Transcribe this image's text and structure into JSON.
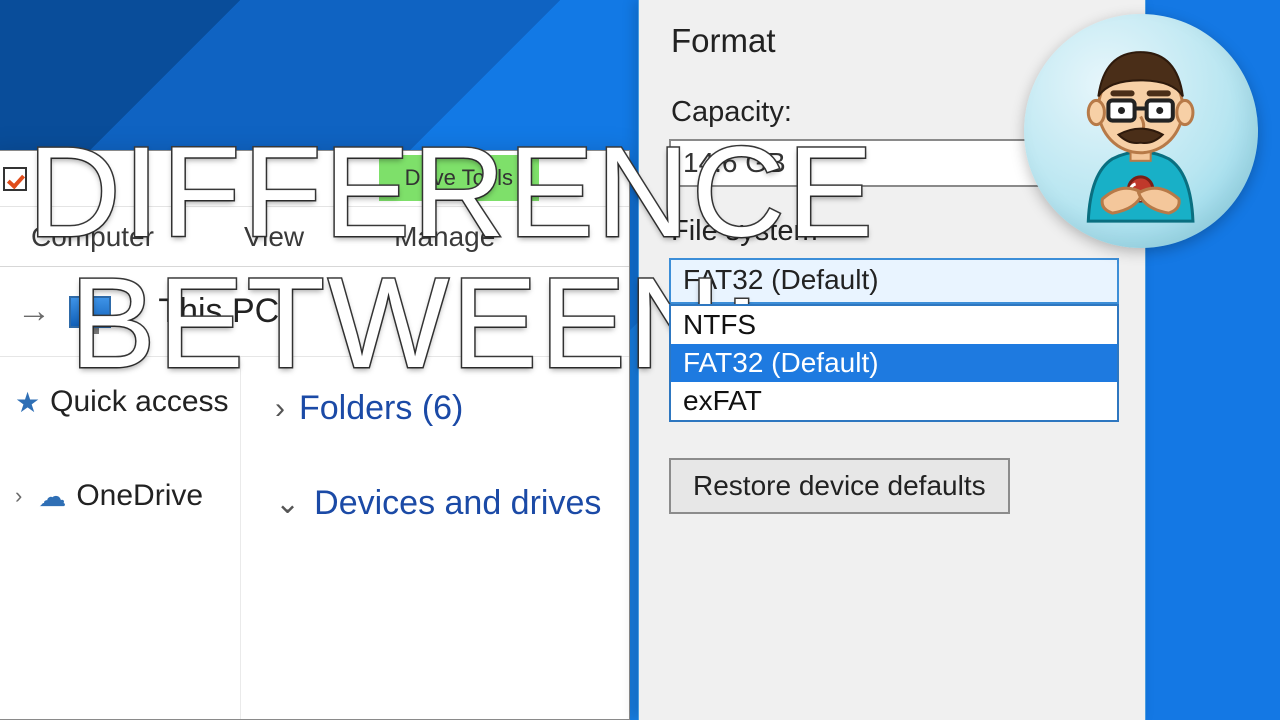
{
  "overlay": {
    "line1": "DIFFERENCE",
    "line2": "BETWEEN:"
  },
  "explorer": {
    "drive_tools": "Drive Tools",
    "ribbon": {
      "computer": "Computer",
      "view": "View",
      "manage": "Manage"
    },
    "address": {
      "path": "This PC"
    },
    "nav": {
      "quick_access": "Quick access",
      "onedrive": "OneDrive"
    },
    "content": {
      "folders": "Folders (6)",
      "devices": "Devices and drives"
    }
  },
  "format": {
    "title": "Format",
    "capacity_label": "Capacity:",
    "capacity_value": "14.6 GB",
    "fs_label": "File system",
    "fs_selected": "FAT32 (Default)",
    "fs_options": {
      "ntfs": "NTFS",
      "fat32": "FAT32 (Default)",
      "exfat": "exFAT"
    },
    "restore_button": "Restore device defaults"
  }
}
